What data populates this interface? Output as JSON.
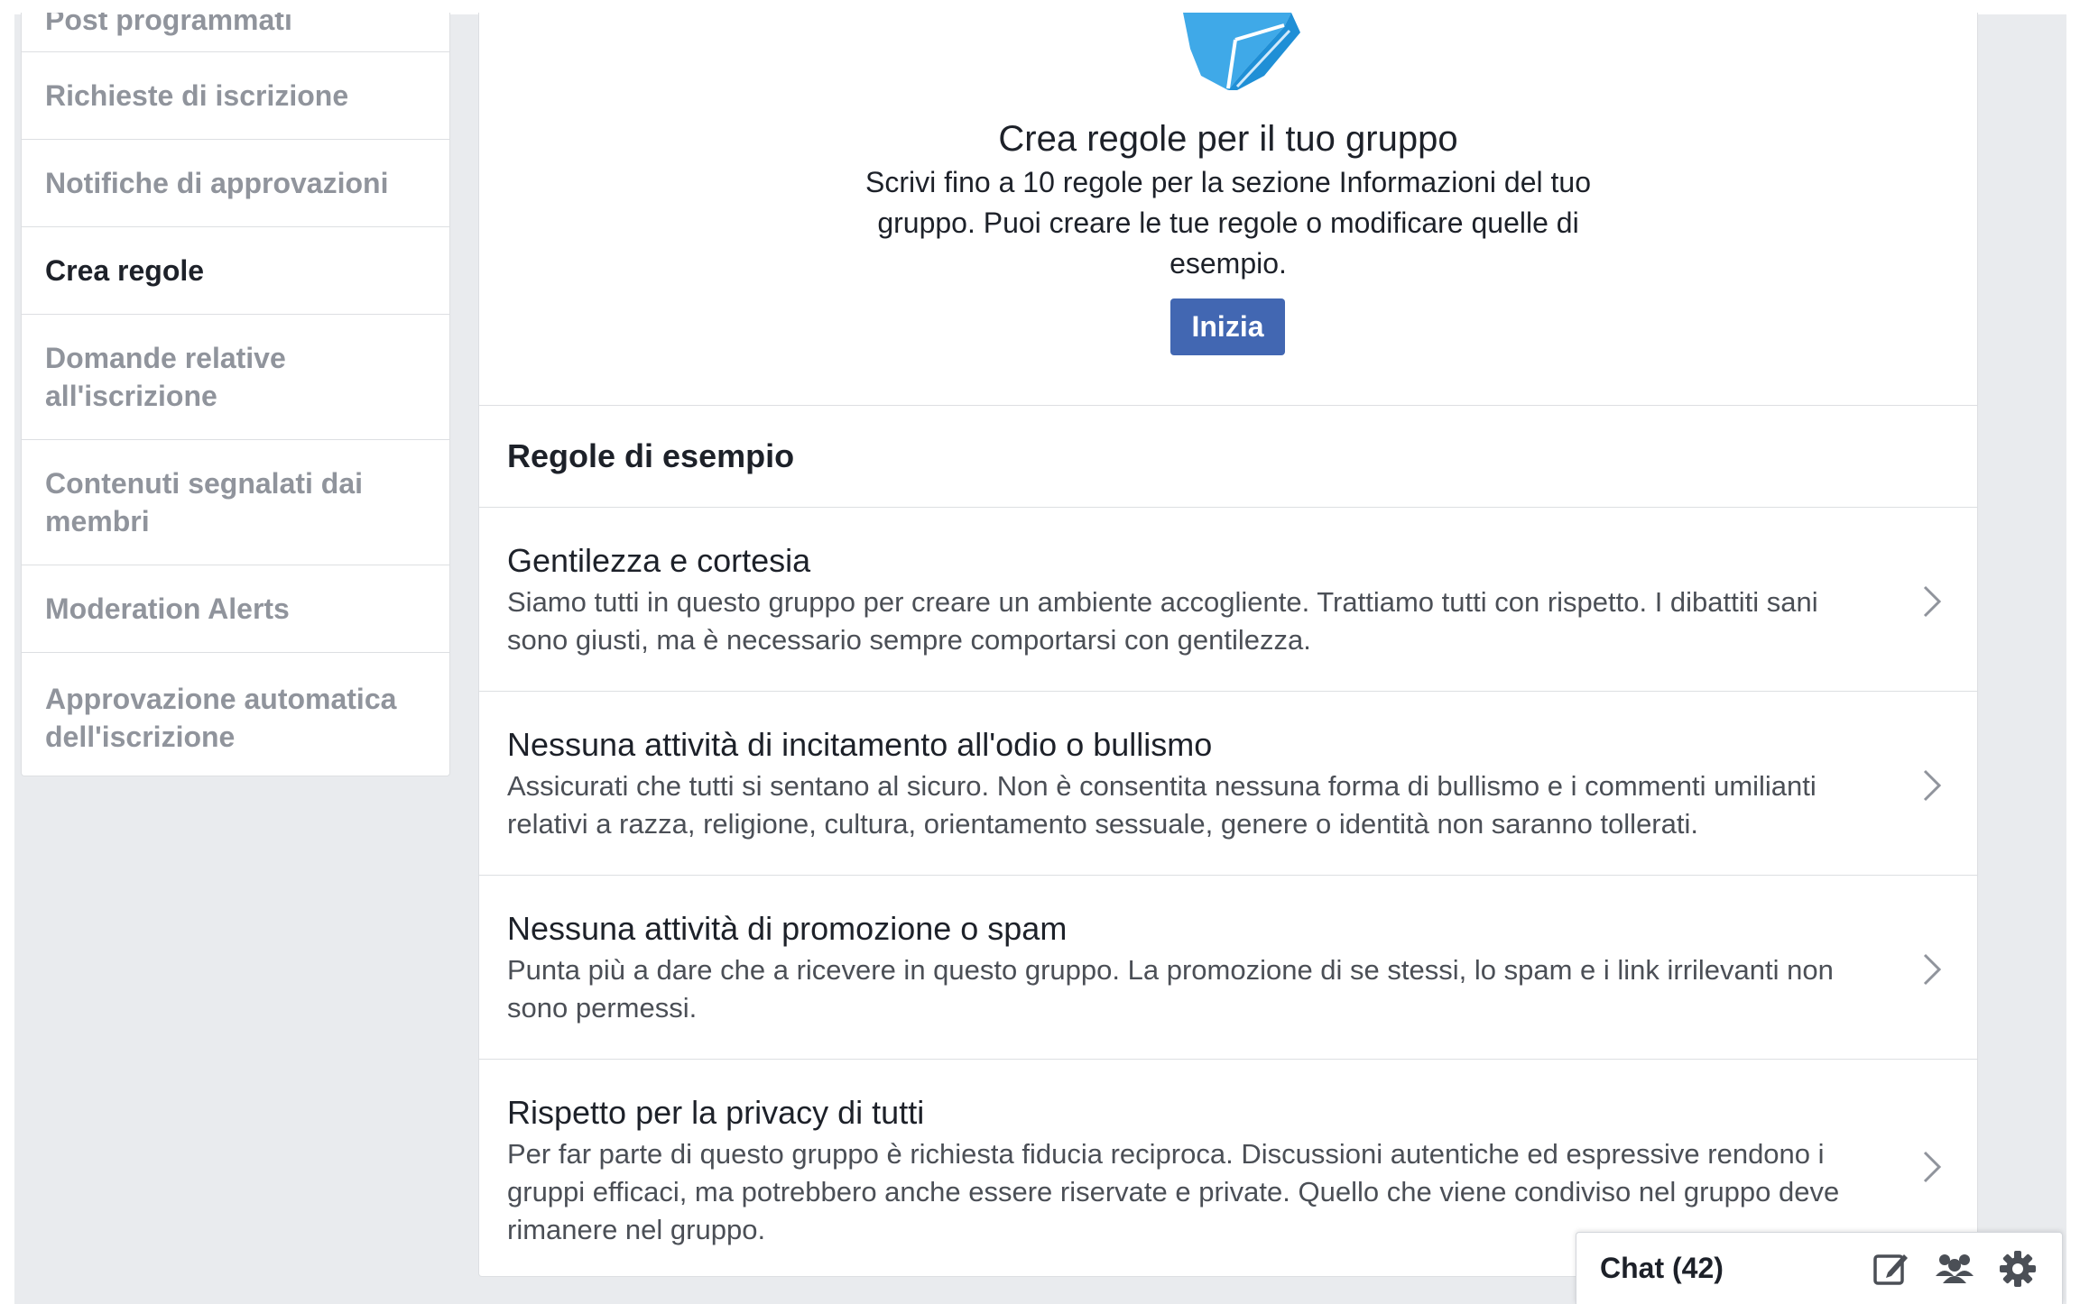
{
  "sidebar": {
    "items": [
      {
        "label": "Post programmati"
      },
      {
        "label": "Richieste di iscrizione"
      },
      {
        "label": "Notifiche di approvazioni"
      },
      {
        "label": "Crea regole"
      },
      {
        "label": "Domande relative all'iscrizione"
      },
      {
        "label": "Contenuti segnalati dai membri"
      },
      {
        "label": "Moderation Alerts"
      },
      {
        "label": "Approvazione automatica dell'iscrizione"
      }
    ],
    "active_index": 3
  },
  "hero": {
    "illustration_icon": "rules-book-illustration",
    "title": "Crea regole per il tuo gruppo",
    "description": "Scrivi fino a 10 regole per la sezione Informazioni del tuo gruppo. Puoi creare le tue regole o modificare quelle di esempio.",
    "button_label": "Inizia"
  },
  "examples": {
    "header": "Regole di esempio",
    "rules": [
      {
        "title": "Gentilezza e cortesia",
        "description": "Siamo tutti in questo gruppo per creare un ambiente accogliente. Trattiamo tutti con rispetto. I dibattiti sani sono giusti, ma è necessario sempre comportarsi con gentilezza."
      },
      {
        "title": "Nessuna attività di incitamento all'odio o bullismo",
        "description": "Assicurati che tutti si sentano al sicuro. Non è consentita nessuna forma di bullismo e i commenti umilianti relativi a razza, religione, cultura, orientamento sessuale, genere o identità non saranno tollerati."
      },
      {
        "title": "Nessuna attività di promozione o spam",
        "description": "Punta più a dare che a ricevere in questo gruppo. La promozione di se stessi, lo spam e i link irrilevanti non sono permessi."
      },
      {
        "title": "Rispetto per la privacy di tutti",
        "description": "Per far parte di questo gruppo è richiesta fiducia reciproca. Discussioni autentiche ed espressive rendono i gruppi efficaci, ma potrebbero anche essere riservate e private. Quello che viene condiviso nel gruppo deve rimanere nel gruppo."
      }
    ]
  },
  "chat": {
    "label": "Chat (42)",
    "icons": [
      "compose-icon",
      "people-icon",
      "gear-icon"
    ]
  },
  "colors": {
    "page_background": "#e9ebee",
    "primary_button": "#4267b2",
    "illustration_blue": "#3fa9e8"
  }
}
